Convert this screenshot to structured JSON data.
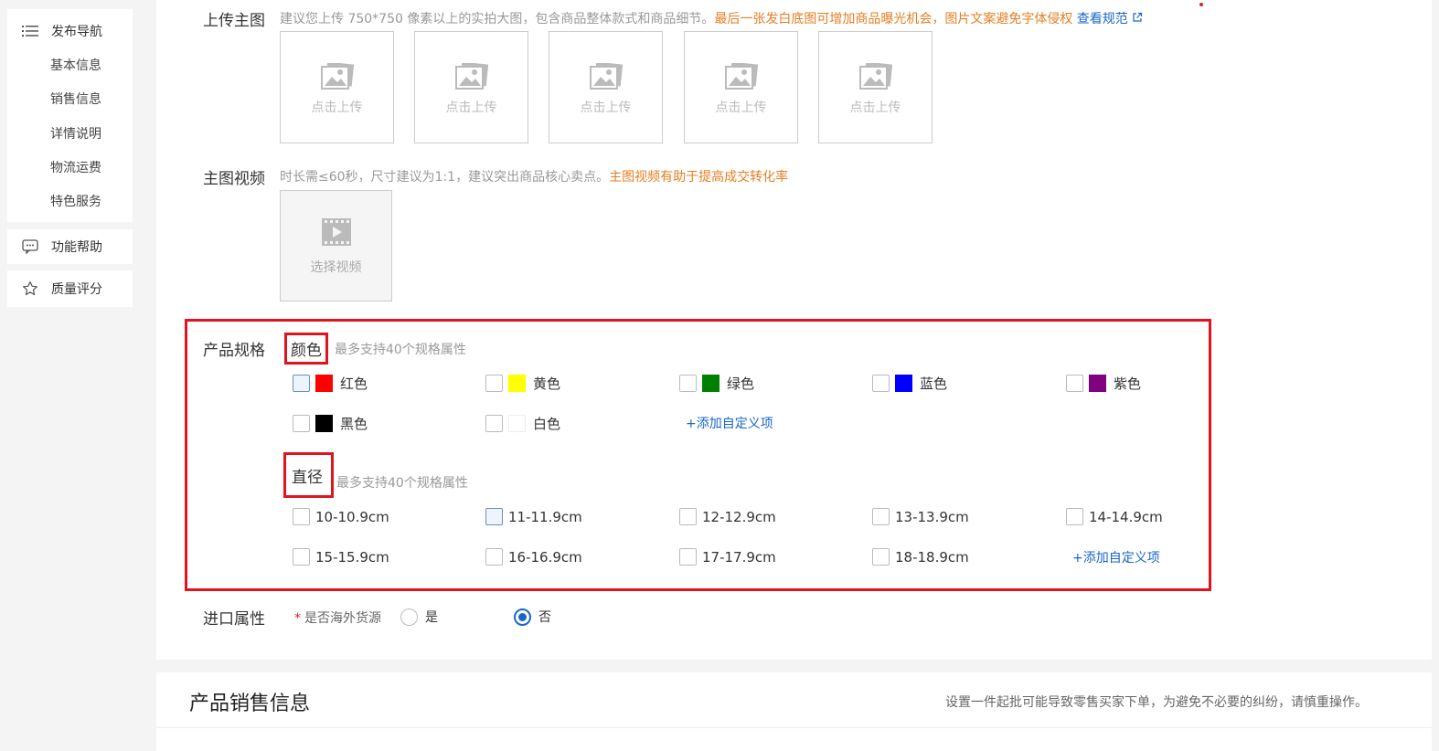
{
  "sidebar": {
    "nav_title": "发布导航",
    "nav_items": [
      "基本信息",
      "销售信息",
      "详情说明",
      "物流运费",
      "特色服务"
    ],
    "help_label": "功能帮助",
    "quality_label": "质量评分"
  },
  "main_image": {
    "label": "上传主图",
    "hint": "建议您上传 750*750 像素以上的实拍大图，包含商品整体款式和商品细节。",
    "warning": "最后一张发白底图可增加商品曝光机会，图片文案避免字体侵权",
    "rules_link": "查看规范",
    "upload_labels": [
      "点击上传",
      "点击上传",
      "点击上传",
      "点击上传",
      "点击上传"
    ]
  },
  "video": {
    "label": "主图视频",
    "hint": "时长需≤60秒，尺寸建议为1:1，建议突出商品核心卖点。",
    "warning": "主图视频有助于提高成交转化率",
    "button_label": "选择视频"
  },
  "spec": {
    "label": "产品规格",
    "color": {
      "title": "颜色",
      "hint": "最多支持40个规格属性",
      "options": [
        {
          "label": "红色",
          "color": "#ff0000",
          "checked": false
        },
        {
          "label": "黄色",
          "color": "#ffff00",
          "checked": false
        },
        {
          "label": "绿色",
          "color": "#008000",
          "checked": false
        },
        {
          "label": "蓝色",
          "color": "#0000ff",
          "checked": false
        },
        {
          "label": "紫色",
          "color": "#800080",
          "checked": false
        },
        {
          "label": "黑色",
          "color": "#000000",
          "checked": false
        },
        {
          "label": "白色",
          "color": "#ffffff",
          "checked": false
        }
      ],
      "add_label": "+添加自定义项"
    },
    "diameter": {
      "title": "直径",
      "hint": "最多支持40个规格属性",
      "options": [
        "10-10.9cm",
        "11-11.9cm",
        "12-12.9cm",
        "13-13.9cm",
        "14-14.9cm",
        "15-15.9cm",
        "16-16.9cm",
        "17-17.9cm",
        "18-18.9cm"
      ],
      "add_label": "+添加自定义项"
    }
  },
  "import_attr": {
    "label": "进口属性",
    "question": "是否海外货源",
    "required_mark": "*",
    "options": [
      "是",
      "否"
    ],
    "selected": "否"
  },
  "sales_info": {
    "title": "产品销售信息",
    "note": "设置一件起批可能导致零售买家下单，为避免不必要的纠纷，请慎重操作。"
  }
}
